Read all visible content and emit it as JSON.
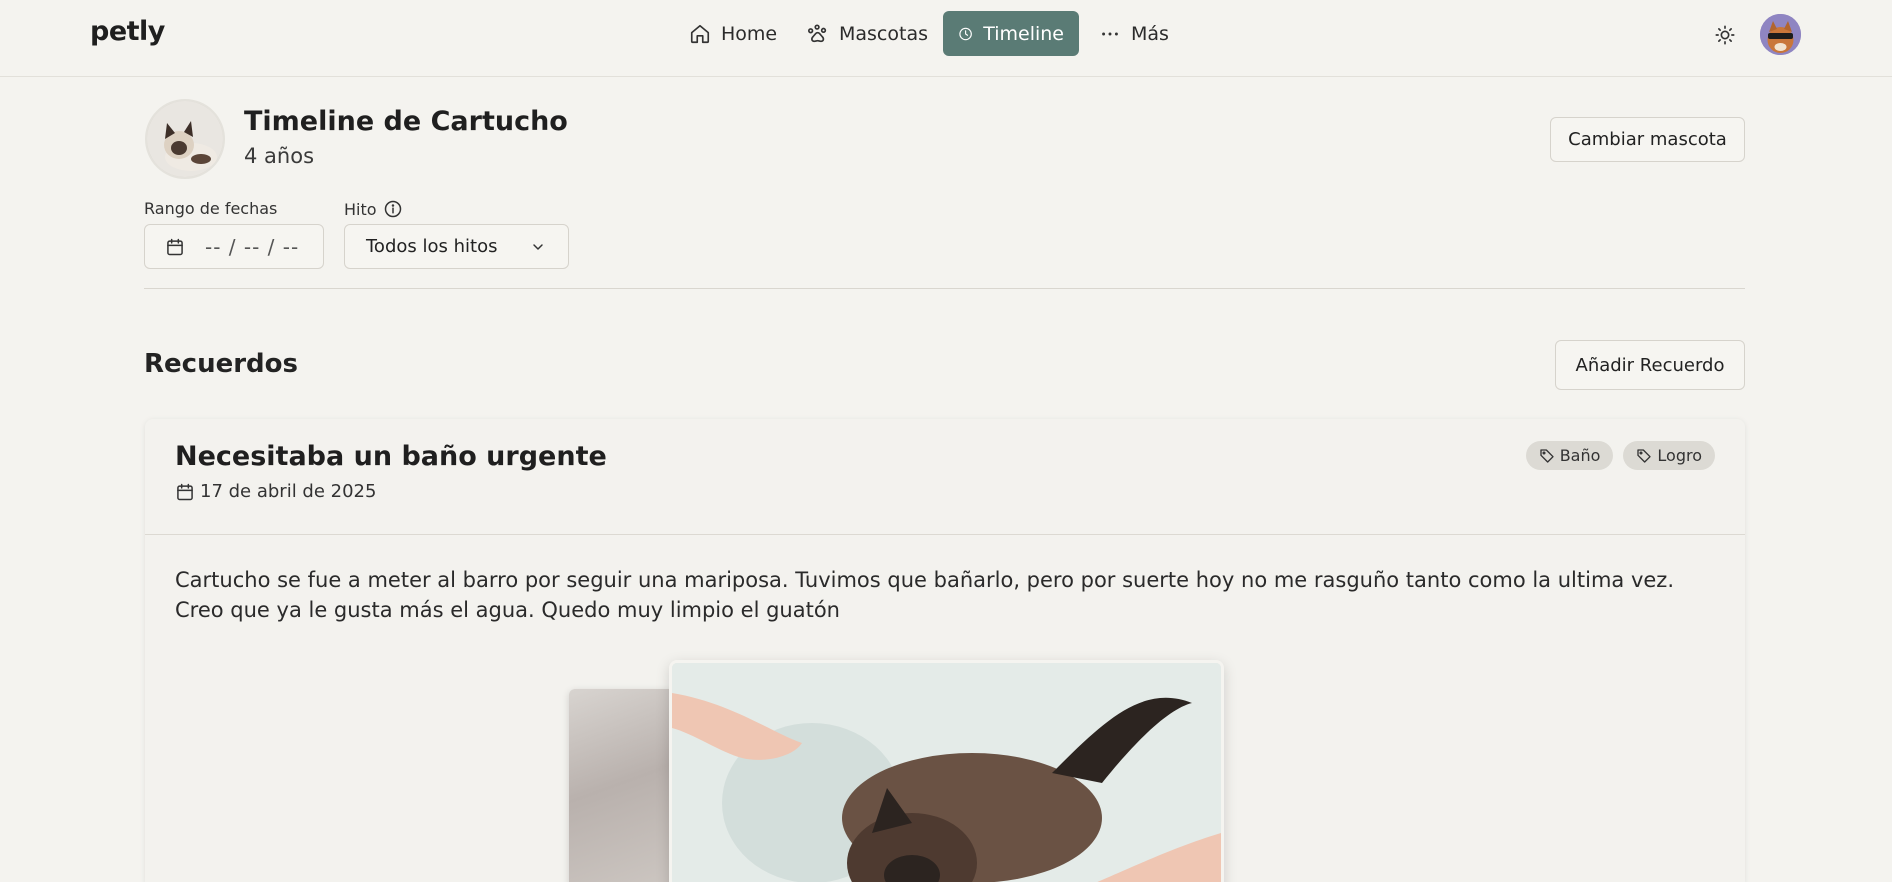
{
  "nav": {
    "logo": "petly",
    "items": [
      {
        "label": "Home",
        "icon": "home-icon"
      },
      {
        "label": "Mascotas",
        "icon": "paw-icon"
      },
      {
        "label": "Timeline",
        "icon": "clock-icon",
        "active": true
      },
      {
        "label": "Más",
        "icon": "more-horizontal-icon"
      }
    ],
    "theme_icon": "sun-icon",
    "accent_color": "#5a7b75"
  },
  "pet": {
    "title": "Timeline de Cartucho",
    "age": "4 años",
    "change_button": "Cambiar mascota"
  },
  "filters": {
    "date_label": "Rango de fechas",
    "date_value": "-- / -- / --",
    "hito_label": "Hito",
    "hito_selected": "Todos los hitos"
  },
  "memories": {
    "section_title": "Recuerdos",
    "add_button": "Añadir Recuerdo",
    "items": [
      {
        "title": "Necesitaba un baño urgente",
        "date": "17 de abril de 2025",
        "tags": [
          "Baño",
          "Logro"
        ],
        "text": "Cartucho se fue a meter al barro por seguir una mariposa. Tuvimos que bañarlo, pero por suerte hoy no me rasguño tanto como la ultima vez. Creo que ya le gusta más el agua. Quedo muy limpio el guatón"
      }
    ]
  }
}
